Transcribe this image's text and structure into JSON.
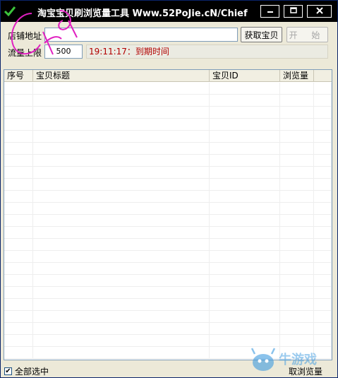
{
  "window": {
    "title": "淘宝宝贝刷浏览量工具 Www.52PoJie.cN/Chief",
    "icons": {
      "app": "checkmark-icon",
      "minimize": "minimize-icon",
      "maximize": "maximize-icon",
      "close": "close-icon"
    }
  },
  "form": {
    "shop_label": "店铺地址",
    "shop_value": "",
    "fetch_button": "获取宝贝",
    "start_button": "开 始",
    "limit_label": "流量上限",
    "limit_value": "500",
    "status_text": "19:11:17：到期时间"
  },
  "table": {
    "columns": [
      "序号",
      "宝贝标题",
      "宝贝ID",
      "浏览量"
    ],
    "rows": []
  },
  "footer": {
    "select_all_label": "全部选中",
    "select_all_checked": true,
    "cancel_label": "取浏览量"
  },
  "watermarks": {
    "signature": "Chief",
    "logo_text": "牛游戏"
  },
  "colors": {
    "title_bg": "#000000",
    "status_text": "#b20000",
    "signature": "#e020c0"
  }
}
